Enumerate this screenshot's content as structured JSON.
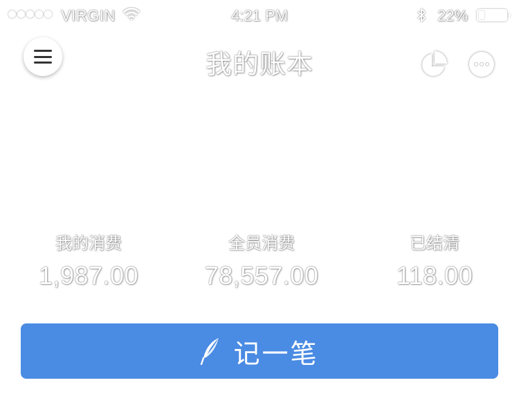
{
  "status_bar": {
    "signal_dots": [
      true,
      true,
      true,
      false,
      false
    ],
    "carrier": "VIRGIN",
    "wifi_icon": "wifi-icon",
    "time": "4:21 PM",
    "bluetooth_icon": "bluetooth-icon",
    "battery_percent": "22%",
    "battery_level": 0.22
  },
  "nav": {
    "menu_icon": "hamburger-menu-icon",
    "title": "我的账本",
    "chart_icon": "pie-chart-icon",
    "more_icon": "more-icon"
  },
  "summary": {
    "my_spending": {
      "label": "我的消费",
      "value": "1,987.00"
    },
    "all_spending": {
      "label": "全员消费",
      "value": "78,557.00"
    },
    "settled": {
      "label": "已结清",
      "value": "118.00"
    }
  },
  "actions": {
    "add_record": {
      "label": "记一笔",
      "icon": "feather-icon"
    }
  },
  "colors": {
    "accent": "#4a8be3",
    "background": "#ffffff",
    "text_halo": "#ffffff"
  }
}
